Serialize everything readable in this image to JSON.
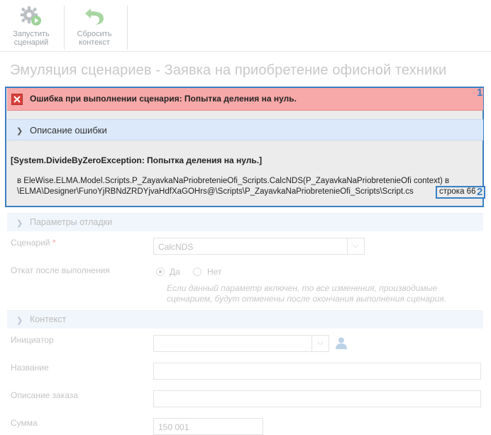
{
  "toolbar": {
    "run_label": "Запустить сценарий",
    "reset_label": "Сбросить контекст",
    "run_icon": "gear-play-icon",
    "reset_icon": "undo-arrow-icon"
  },
  "page_title": "Эмуляция сценариев - Заявка на приобретение офисной техники",
  "error": {
    "message": "Ошибка при выполнении сценария: Попытка деления на нуль.",
    "annotation_1": "1",
    "description_label": "Описание ошибки",
    "exception": "[System.DivideByZeroException: Попытка деления на нуль.]",
    "trace_line1": "в EleWise.ELMA.Model.Scripts.P_ZayavkaNaPriobretenieOfi_Scripts.CalcNDS(P_ZayavkaNaPriobretenieOfi context) в",
    "trace_line2": "\\ELMA\\Designer\\FunoYjRBNdZRDYjvaHdfXaGOHrs@\\Scripts\\P_ZayavkaNaPriobretenieOfi_Scripts\\Script.cs",
    "line_ref": "строка 66",
    "annotation_2": "2",
    "colors": {
      "error_bg": "#f7a8a8",
      "annotation": "#3a7fc4"
    }
  },
  "debug": {
    "section_label": "Параметры отладки",
    "scenario_label": "Сценарий",
    "required_mark": "*",
    "scenario_value": "CalcNDS",
    "rollback_label": "Откат после выполнения",
    "yes_label": "Да",
    "no_label": "Нет",
    "hint_line1": "Если данный параметр включен, то все изменения, производимые",
    "hint_line2": "сценарием, будут отменены после окончания выполнения сценария."
  },
  "context": {
    "section_label": "Контекст",
    "initiator_label": "Инициатор",
    "name_label": "Название",
    "order_desc_label": "Описание заказа",
    "sum_label": "Сумма",
    "sum_value": "150 001"
  }
}
